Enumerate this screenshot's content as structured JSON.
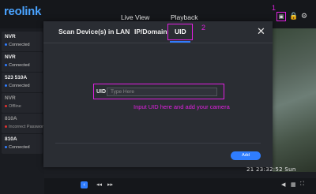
{
  "app": {
    "logo": "reolink"
  },
  "nav": {
    "live_view": "Live View",
    "playback": "Playback"
  },
  "sidebar": {
    "devices": [
      {
        "name": "NVR",
        "status": "Connected",
        "status_color": "#2f7dff",
        "dimmed": false
      },
      {
        "name": "NVR",
        "status": "Connected",
        "status_color": "#2f7dff",
        "dimmed": false
      },
      {
        "name": "523 510A",
        "status": "Connected",
        "status_color": "#2f7dff",
        "dimmed": false
      },
      {
        "name": "NVR",
        "status": "Offline",
        "status_color": "#e03131",
        "dimmed": true
      },
      {
        "name": "810A",
        "status": "Incorrect Password",
        "status_color": "#e03131",
        "dimmed": true
      },
      {
        "name": "810A",
        "status": "Connected",
        "status_color": "#2f7dff",
        "dimmed": false
      }
    ]
  },
  "video": {
    "timestamp": "21 23:32:52 Sun"
  },
  "modal": {
    "tabs": [
      "Scan Device(s) in LAN",
      "IP/Domain",
      "UID"
    ],
    "active_tab": "UID",
    "close_icon": "close-icon",
    "uid_label": "UID",
    "uid_placeholder": "Type Here",
    "add_label": "Add"
  },
  "annotations": {
    "step1": "1",
    "step2": "2",
    "instruction": "Input UID here and add your camera",
    "color": "#e020e0"
  },
  "colors": {
    "accent": "#2f7dff",
    "background": "#1b1d22",
    "modal": "#2a2d33"
  }
}
